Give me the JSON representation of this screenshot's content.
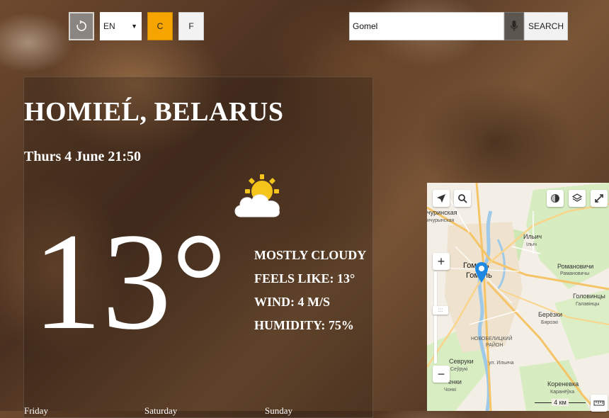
{
  "toolbar": {
    "refresh_icon": "refresh-icon",
    "language": "EN",
    "unit_c": "C",
    "unit_f": "F",
    "search_value": "Gomel",
    "mic_icon": "microphone-icon",
    "search_label": "SEARCH",
    "active_unit_color": "#f5a400"
  },
  "weather": {
    "location": "HOMIEĹ, BELARUS",
    "datetime": "Thurs 4 June 21:50",
    "icon": "partly-cloudy-icon",
    "temperature": "13°",
    "condition": "MOSTLY CLOUDY",
    "feels_like": "FEELS LIKE: 13°",
    "wind": "WIND: 4 M/S",
    "humidity": "HUMIDITY: 75%"
  },
  "forecast": {
    "days": [
      "Friday",
      "Saturday",
      "Sunday"
    ]
  },
  "map": {
    "labels": {
      "chirinskaya_1": "чуринская",
      "chirinskaya_2": "ичурынская",
      "ilich": "Ильич",
      "ilich_by": "Ільіч",
      "gomel": "Гомель",
      "gomel_by": "Гомель",
      "romanovichi": "Романовичи",
      "romanovichi_by": "Рамановичы",
      "golovintsy": "Головинцы",
      "golovintsy_by": "Галавінцы",
      "berezki": "Берёзки",
      "berezki_by": "Бярозкі",
      "district_1": "НОВОБЕЛИЦКИЙ",
      "district_2": "РАЙОН",
      "sevruki": "Севруки",
      "sevruki_by": "Сеўрукі",
      "ulitsa": "ул. Ильича",
      "chenki": "енки",
      "chenki_by": "Чонкі",
      "korenevka": "Кореневка",
      "korenevka_by": "Каранёўка"
    },
    "scale": "4 км",
    "zoom_in": "+",
    "zoom_out": "−",
    "zoom_handle": ":::",
    "marker_color": "#1e88e5"
  }
}
